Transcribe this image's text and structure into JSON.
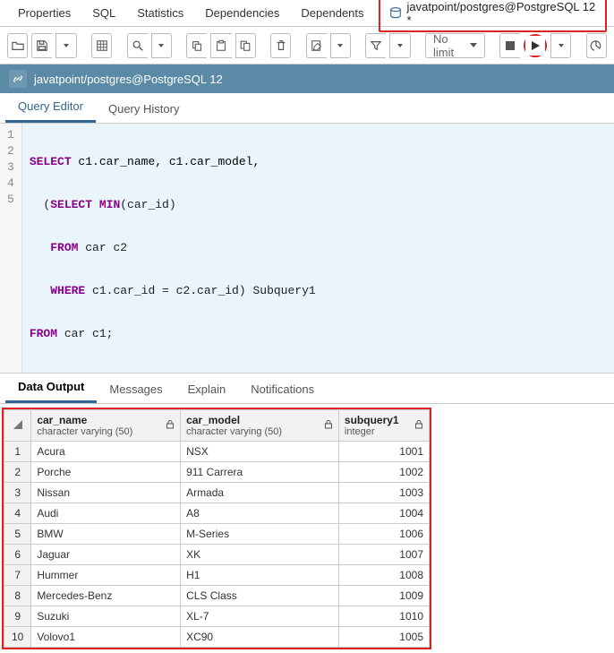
{
  "top_tabs": {
    "properties": "Properties",
    "sql": "SQL",
    "statistics": "Statistics",
    "dependencies": "Dependencies",
    "dependents": "Dependents"
  },
  "conn_tab": "javatpoint/postgres@PostgreSQL 12 *",
  "toolbar": {
    "nolimit": "No limit"
  },
  "conn_bar": "javatpoint/postgres@PostgreSQL 12",
  "editor_tabs": {
    "query_editor": "Query Editor",
    "query_history": "Query History"
  },
  "code": {
    "l1": [
      "SELECT",
      " c1.car_name, c1.car_model,"
    ],
    "l2a": "  (",
    "l2b": "SELECT",
    "l2c": " ",
    "l2d": "MIN",
    "l2e": "(car_id)",
    "l3a": "   ",
    "l3b": "FROM",
    "l3c": " car c2",
    "l4a": "   ",
    "l4b": "WHERE",
    "l4c": " c1.car_id = c2.car_id) Subquery1",
    "l5a": "FROM",
    "l5b": " car c1;"
  },
  "out_tabs": {
    "data_output": "Data Output",
    "messages": "Messages",
    "explain": "Explain",
    "notifications": "Notifications"
  },
  "columns": {
    "c1_name": "car_name",
    "c1_type": "character varying (50)",
    "c2_name": "car_model",
    "c2_type": "character varying (50)",
    "c3_name": "subquery1",
    "c3_type": "integer"
  },
  "rows": [
    {
      "n": "1",
      "car_name": "Acura",
      "car_model": "NSX",
      "subquery1": "1001"
    },
    {
      "n": "2",
      "car_name": "Porche",
      "car_model": "911 Carrera",
      "subquery1": "1002"
    },
    {
      "n": "3",
      "car_name": "Nissan",
      "car_model": "Armada",
      "subquery1": "1003"
    },
    {
      "n": "4",
      "car_name": "Audi",
      "car_model": "A8",
      "subquery1": "1004"
    },
    {
      "n": "5",
      "car_name": "BMW",
      "car_model": "M-Series",
      "subquery1": "1006"
    },
    {
      "n": "6",
      "car_name": "Jaguar",
      "car_model": "XK",
      "subquery1": "1007"
    },
    {
      "n": "7",
      "car_name": "Hummer",
      "car_model": "H1",
      "subquery1": "1008"
    },
    {
      "n": "8",
      "car_name": "Mercedes-Benz",
      "car_model": "CLS Class",
      "subquery1": "1009"
    },
    {
      "n": "9",
      "car_name": "Suzuki",
      "car_model": "XL-7",
      "subquery1": "1010"
    },
    {
      "n": "10",
      "car_name": "Volovo1",
      "car_model": "XC90",
      "subquery1": "1005"
    }
  ]
}
